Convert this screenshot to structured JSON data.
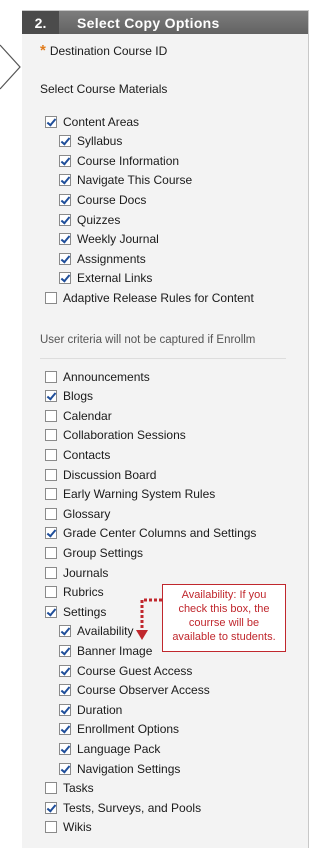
{
  "section": {
    "step": "2.",
    "title": "Select Copy Options"
  },
  "destination_label": "Destination Course ID",
  "materials_label": "Select Course Materials",
  "content_areas": {
    "label": "Content Areas",
    "checked": true,
    "items": [
      {
        "label": "Syllabus",
        "checked": true
      },
      {
        "label": "Course Information",
        "checked": true
      },
      {
        "label": "Navigate This Course",
        "checked": true
      },
      {
        "label": "Course Docs",
        "checked": true
      },
      {
        "label": "Quizzes",
        "checked": true
      },
      {
        "label": "Weekly Journal",
        "checked": true
      },
      {
        "label": "Assignments",
        "checked": true
      },
      {
        "label": "External Links",
        "checked": true
      }
    ]
  },
  "adaptive_release": {
    "label": "Adaptive Release Rules for Content",
    "checked": false
  },
  "adaptive_note": "User criteria will not be captured if Enrollm",
  "materials": [
    {
      "label": "Announcements",
      "checked": false
    },
    {
      "label": "Blogs",
      "checked": true
    },
    {
      "label": "Calendar",
      "checked": false
    },
    {
      "label": "Collaboration Sessions",
      "checked": false
    },
    {
      "label": "Contacts",
      "checked": false
    },
    {
      "label": "Discussion Board",
      "checked": false
    },
    {
      "label": "Early Warning System Rules",
      "checked": false
    },
    {
      "label": "Glossary",
      "checked": false
    },
    {
      "label": "Grade Center Columns and Settings",
      "checked": true
    },
    {
      "label": "Group Settings",
      "checked": false
    },
    {
      "label": "Journals",
      "checked": false
    },
    {
      "label": "Rubrics",
      "checked": false
    }
  ],
  "settings": {
    "label": "Settings",
    "checked": true,
    "items": [
      {
        "label": "Availability",
        "checked": true
      },
      {
        "label": "Banner Image",
        "checked": true
      },
      {
        "label": "Course Guest Access",
        "checked": true
      },
      {
        "label": "Course Observer Access",
        "checked": true
      },
      {
        "label": "Duration",
        "checked": true
      },
      {
        "label": "Enrollment Options",
        "checked": true
      },
      {
        "label": "Language Pack",
        "checked": true
      },
      {
        "label": "Navigation Settings",
        "checked": true
      }
    ]
  },
  "after_settings": [
    {
      "label": "Tasks",
      "checked": false
    },
    {
      "label": "Tests, Surveys, and Pools",
      "checked": true
    },
    {
      "label": "Wikis",
      "checked": false
    }
  ],
  "callout": "Availability: If you check this box, the courrse will be available to students.",
  "colors": {
    "accent_star": "#e07b1a",
    "callout": "#c0272d",
    "check": "#1f4e9a"
  }
}
